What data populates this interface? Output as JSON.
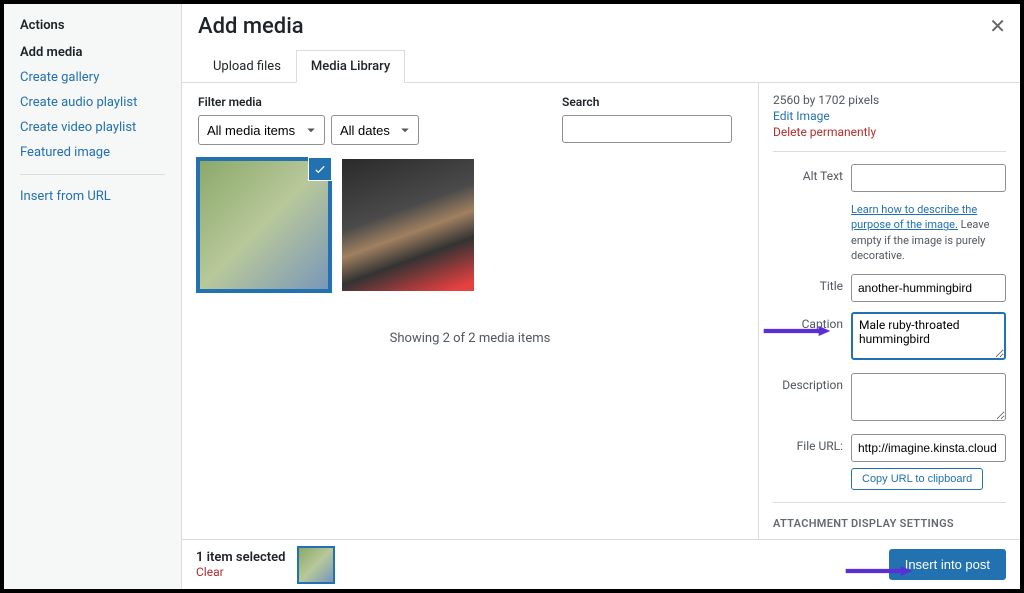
{
  "sidebar": {
    "title": "Actions",
    "section": "Add media",
    "links": [
      "Create gallery",
      "Create audio playlist",
      "Create video playlist",
      "Featured image"
    ],
    "insert_url": "Insert from URL"
  },
  "header": {
    "title": "Add media"
  },
  "tabs": {
    "upload": "Upload files",
    "library": "Media Library"
  },
  "filters": {
    "label": "Filter media",
    "type_value": "All media items",
    "date_value": "All dates",
    "search_label": "Search"
  },
  "gallery": {
    "showing": "Showing 2 of 2 media items"
  },
  "details": {
    "dimensions": "2560 by 1702 pixels",
    "edit_image": "Edit Image",
    "delete": "Delete permanently",
    "alt_label": "Alt Text",
    "alt_help_link": "Learn how to describe the purpose of the image.",
    "alt_help_rest": " Leave empty if the image is purely decorative.",
    "title_label": "Title",
    "title_value": "another-hummingbird",
    "caption_label": "Caption",
    "caption_value": "Male ruby-throated hummingbird",
    "description_label": "Description",
    "fileurl_label": "File URL:",
    "fileurl_value": "http://imagine.kinsta.cloud",
    "copy_btn": "Copy URL to clipboard",
    "display_heading": "ATTACHMENT DISPLAY SETTINGS"
  },
  "toolbar": {
    "selected": "1 item selected",
    "clear": "Clear",
    "insert": "Insert into post"
  }
}
